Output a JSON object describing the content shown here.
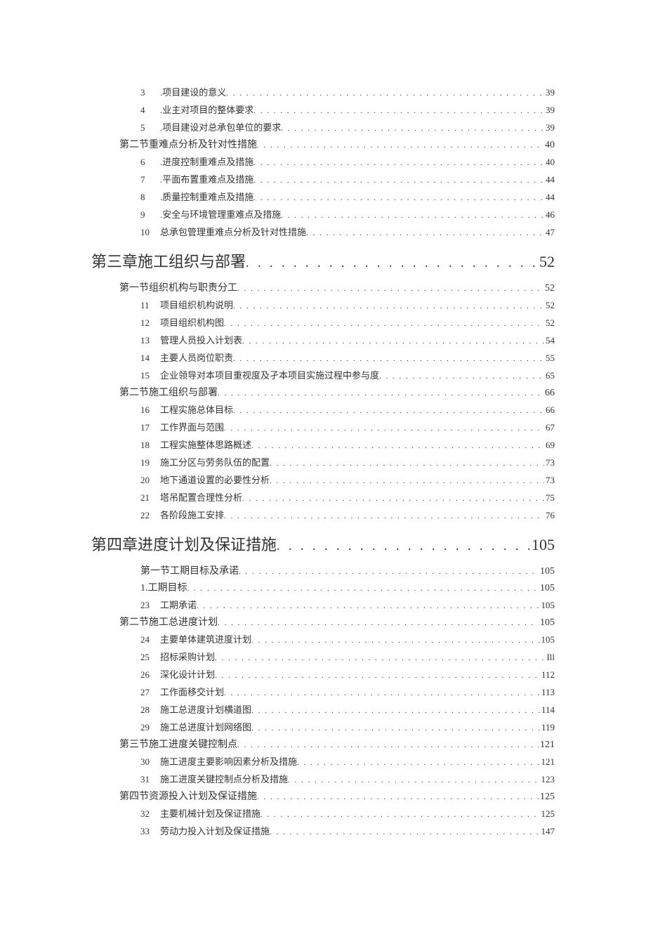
{
  "entries": [
    {
      "level": "lvl3",
      "num": "3",
      "title": ".项目建设的意义",
      "page": "39"
    },
    {
      "level": "lvl3",
      "num": "4",
      "title": ".业主对项目的整体要求",
      "page": "39"
    },
    {
      "level": "lvl3",
      "num": "5",
      "title": ".项目建设对总承包单位的要求",
      "page": "39"
    },
    {
      "level": "lvl2",
      "num": "",
      "title": "第二节重难点分析及针对性措施",
      "page": "40"
    },
    {
      "level": "lvl3",
      "num": "6",
      "title": ".进度控制重难点及措施",
      "page": "40"
    },
    {
      "level": "lvl3",
      "num": "7",
      "title": ".平面布置重难点及措施",
      "page": "44"
    },
    {
      "level": "lvl3",
      "num": "8",
      "title": ".质量控制重难点及措施",
      "page": "44"
    },
    {
      "level": "lvl3",
      "num": "9",
      "title": ".安全与环境管理重难点及措施",
      "page": "46"
    },
    {
      "level": "lvl3",
      "num": "10",
      "title": "总承包管理重难点分析及针对性措施",
      "page": "47"
    },
    {
      "level": "lvl1",
      "num": "",
      "title": "第三章施工组织与部署",
      "page": "52"
    },
    {
      "level": "lvl2",
      "num": "",
      "title": "第一节组织机构与职责分工",
      "page": "52"
    },
    {
      "level": "lvl3",
      "num": "11",
      "title": "项目组织机构说明",
      "page": "52"
    },
    {
      "level": "lvl3",
      "num": "12",
      "title": "项目组织机构图",
      "page": "52"
    },
    {
      "level": "lvl3",
      "num": "13",
      "title": "管理人员投入计划表",
      "page": "54"
    },
    {
      "level": "lvl3",
      "num": "14",
      "title": "主要人员岗位职责",
      "page": "55"
    },
    {
      "level": "lvl3",
      "num": "15",
      "title": "企业领导对本项目重视度及孑本项目实施过程中参与度",
      "page": "65"
    },
    {
      "level": "lvl2",
      "num": "",
      "title": "第二节施工组织与部署",
      "page": "66"
    },
    {
      "level": "lvl3",
      "num": "16",
      "title": "工程实施总体目标",
      "page": "66"
    },
    {
      "level": "lvl3",
      "num": "17",
      "title": "工作界面与范围",
      "page": "67"
    },
    {
      "level": "lvl3",
      "num": "18",
      "title": "工程实施整体思路概述",
      "page": "69"
    },
    {
      "level": "lvl3",
      "num": "19",
      "title": "施工分区与劳务队伍的配置",
      "page": "73"
    },
    {
      "level": "lvl3",
      "num": "20",
      "title": "地下通道设置的必要性分析",
      "page": "73"
    },
    {
      "level": "lvl3",
      "num": "21",
      "title": "塔吊配置合理性分析",
      "page": "75"
    },
    {
      "level": "lvl3",
      "num": "22",
      "title": "各阶段施工安排",
      "page": "76"
    },
    {
      "level": "lvl1",
      "num": "",
      "title": "第四章进度计划及保证措施",
      "page": "105"
    },
    {
      "level": "lvl2b",
      "num": "",
      "title": "第一节工期目标及承诺",
      "page": "105"
    },
    {
      "level": "lvl2b",
      "num": "",
      "title": "1.工期目标",
      "page": "105"
    },
    {
      "level": "lvl3",
      "num": "23",
      "title": "工期承诺",
      "page": "105"
    },
    {
      "level": "lvl2",
      "num": "",
      "title": "第二节施工总进度计划",
      "page": "105"
    },
    {
      "level": "lvl3",
      "num": "24",
      "title": "主要单体建筑进度计划",
      "page": "105"
    },
    {
      "level": "lvl3",
      "num": "25",
      "title": "招标采购计划",
      "page": "Ill"
    },
    {
      "level": "lvl3",
      "num": "26",
      "title": "深化设计计划",
      "page": "112"
    },
    {
      "level": "lvl3",
      "num": "27",
      "title": "工作面移交计划",
      "page": "113"
    },
    {
      "level": "lvl3",
      "num": "28",
      "title": "施工总进度计划横道图",
      "page": "114"
    },
    {
      "level": "lvl3",
      "num": "29",
      "title": "施工总进度计划网络图",
      "page": "119"
    },
    {
      "level": "lvl2",
      "num": "",
      "title": "第三节施工进度关键控制点",
      "page": "121"
    },
    {
      "level": "lvl3",
      "num": "30",
      "title": "施工进度主要影响因素分析及措施",
      "page": "121"
    },
    {
      "level": "lvl3",
      "num": "31",
      "title": "施工进度关键控制点分析及措施",
      "page": "123"
    },
    {
      "level": "lvl2",
      "num": "",
      "title": "第四节资源投入计划及保证措施",
      "page": "125"
    },
    {
      "level": "lvl3",
      "num": "32",
      "title": "主要机械计划及保证措施",
      "page": "125"
    },
    {
      "level": "lvl3",
      "num": "33",
      "title": "劳动力投入计划及保证措施",
      "page": "147"
    }
  ]
}
